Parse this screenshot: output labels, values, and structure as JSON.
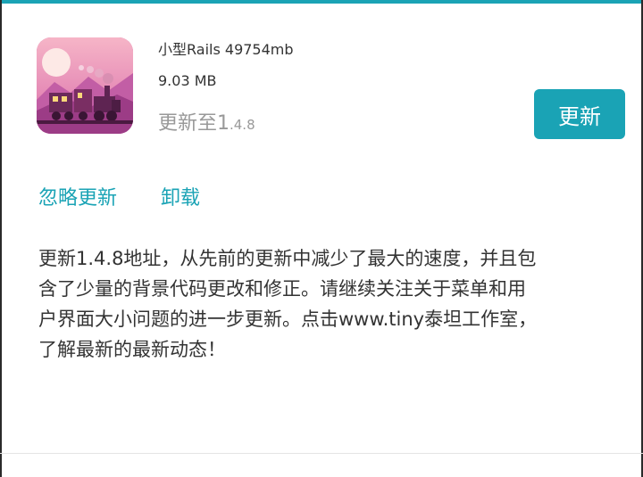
{
  "app": {
    "name": "小型Rails 49754mb",
    "size": "9.03 MB",
    "update_to_prefix": "更新至1",
    "update_to_version": ".4.8",
    "icon": "train-game-icon"
  },
  "actions": {
    "update_label": "更新",
    "ignore_label": "忽略更新",
    "uninstall_label": "卸载"
  },
  "release_notes": {
    "lines": [
      "更新1.4.8地址，从先前的更新中减少了最大的速度，并且包",
      "含了少量的背景代码更改和修正。请继续关注关于菜单和用",
      "户界面大小问题的进一步更新。点击www.tiny泰坦工作室，",
      "了解最新的最新动态！"
    ]
  },
  "colors": {
    "accent": "#1aa3b5",
    "text": "#333333",
    "muted": "#999999"
  }
}
